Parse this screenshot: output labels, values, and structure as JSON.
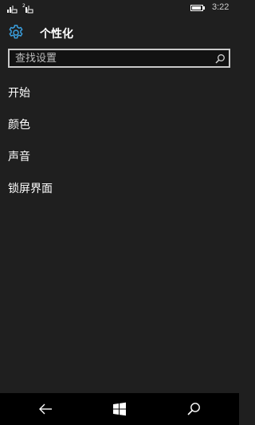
{
  "status_bar": {
    "time": "3:22",
    "battery_level": 0.9,
    "signal_icon_1": "signal-no-sim-icon",
    "signal_icon_2": "signal-no-sim-icon"
  },
  "header": {
    "icon": "gear-icon",
    "title": "个性化"
  },
  "search": {
    "placeholder": "查找设置",
    "icon": "search-icon"
  },
  "menu": {
    "items": [
      {
        "label": "开始"
      },
      {
        "label": "颜色"
      },
      {
        "label": "声音"
      },
      {
        "label": "锁屏界面"
      }
    ]
  },
  "nav_bar": {
    "back_icon": "back-arrow-icon",
    "home_icon": "windows-logo-icon",
    "search_icon": "search-icon"
  },
  "colors": {
    "background": "#1f1f1f",
    "accent": "#3aa0e0",
    "nav_bar": "#000000"
  }
}
